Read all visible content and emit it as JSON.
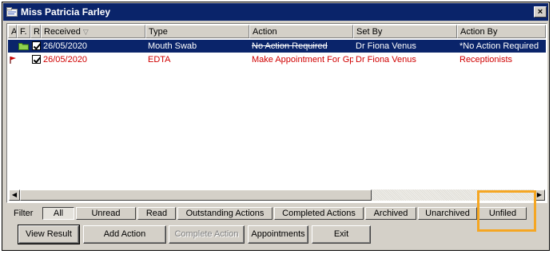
{
  "window": {
    "title": "Miss Patricia Farley",
    "close_glyph": "×"
  },
  "grid": {
    "columns": [
      "A.",
      "F.",
      "R.",
      "Received",
      "Type",
      "Action",
      "Set By",
      "Action By"
    ],
    "sort_glyph": "▽",
    "rows": [
      {
        "received": "26/05/2020",
        "type": "Mouth Swab",
        "action": "No Action Required",
        "set_by": "Dr Fiona Venus",
        "action_by": "*No Action Required",
        "selected": true,
        "icon": "folder-icon",
        "checked": true
      },
      {
        "received": "26/05/2020",
        "type": "EDTA",
        "action": "Make Appointment For Gp",
        "set_by": "Dr Fiona Venus",
        "action_by": "Receptionists",
        "selected": false,
        "icon": "flag-icon",
        "color": "#d00000",
        "checked": true
      }
    ]
  },
  "scrollbar": {
    "left_glyph": "◀",
    "right_glyph": "▶"
  },
  "filter": {
    "label": "Filter",
    "tabs": [
      "All",
      "Unread",
      "Read",
      "Outstanding Actions",
      "Completed Actions",
      "Archived",
      "Unarchived",
      "Unfiled"
    ],
    "active": "All"
  },
  "buttons": {
    "view_result": "View Result",
    "add_action": "Add Action",
    "complete_action": "Complete Action",
    "appointments": "Appointments",
    "exit": "Exit"
  },
  "colors": {
    "title_bar": "#0a246a",
    "selection": "#0a246a",
    "highlight_box": "#f5a623",
    "red_text": "#d00000"
  }
}
